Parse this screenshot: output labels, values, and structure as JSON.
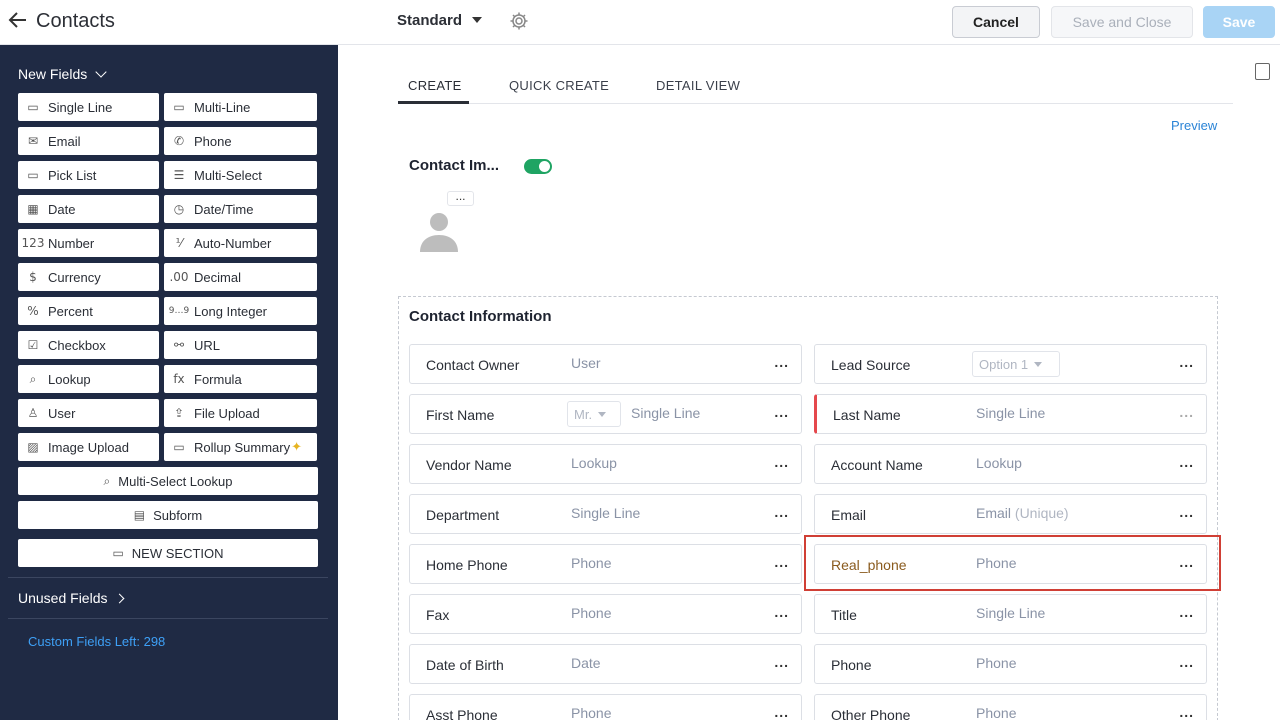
{
  "header": {
    "back_icon": "arrow-left-icon",
    "title": "Contacts",
    "layout_name": "Standard",
    "cancel_label": "Cancel",
    "save_close_label": "Save and Close",
    "save_label": "Save"
  },
  "sidebar": {
    "new_fields_label": "New Fields",
    "field_types": [
      {
        "label": "Single Line",
        "icon": "single-line-icon"
      },
      {
        "label": "Multi-Line",
        "icon": "multi-line-icon"
      },
      {
        "label": "Email",
        "icon": "email-icon"
      },
      {
        "label": "Phone",
        "icon": "phone-icon"
      },
      {
        "label": "Pick List",
        "icon": "pick-list-icon"
      },
      {
        "label": "Multi-Select",
        "icon": "multi-select-icon"
      },
      {
        "label": "Date",
        "icon": "date-icon"
      },
      {
        "label": "Date/Time",
        "icon": "date-time-icon"
      },
      {
        "label": "Number",
        "icon": "number-icon"
      },
      {
        "label": "Auto-Number",
        "icon": "auto-number-icon"
      },
      {
        "label": "Currency",
        "icon": "currency-icon"
      },
      {
        "label": "Decimal",
        "icon": "decimal-icon"
      },
      {
        "label": "Percent",
        "icon": "percent-icon"
      },
      {
        "label": "Long Integer",
        "icon": "long-integer-icon"
      },
      {
        "label": "Checkbox",
        "icon": "checkbox-icon"
      },
      {
        "label": "URL",
        "icon": "url-icon"
      },
      {
        "label": "Lookup",
        "icon": "lookup-icon"
      },
      {
        "label": "Formula",
        "icon": "formula-icon"
      },
      {
        "label": "User",
        "icon": "user-icon"
      },
      {
        "label": "File Upload",
        "icon": "file-upload-icon"
      },
      {
        "label": "Image Upload",
        "icon": "image-upload-icon"
      },
      {
        "label": "Rollup Summary",
        "icon": "rollup-summary-icon"
      }
    ],
    "multi_select_lookup_label": "Multi-Select Lookup",
    "subform_label": "Subform",
    "new_section_label": "NEW SECTION",
    "unused_fields_label": "Unused Fields",
    "custom_fields_left": "Custom Fields Left: 298"
  },
  "main": {
    "tabs": [
      {
        "label": "CREATE",
        "active": true
      },
      {
        "label": "QUICK CREATE",
        "active": false
      },
      {
        "label": "DETAIL VIEW",
        "active": false
      }
    ],
    "preview_label": "Preview",
    "contact_image_label": "Contact Im...",
    "contact_image_enabled": true,
    "section_title": "Contact Information",
    "left_fields": [
      {
        "label": "Contact Owner",
        "type": "User"
      },
      {
        "label": "First Name",
        "type": "Single Line",
        "salutation": "Mr."
      },
      {
        "label": "Vendor Name",
        "type": "Lookup"
      },
      {
        "label": "Department",
        "type": "Single Line"
      },
      {
        "label": "Home Phone",
        "type": "Phone"
      },
      {
        "label": "Fax",
        "type": "Phone"
      },
      {
        "label": "Date of Birth",
        "type": "Date"
      },
      {
        "label": "Asst Phone",
        "type": "Phone"
      }
    ],
    "right_fields": [
      {
        "label": "Lead Source",
        "type": "Option 1"
      },
      {
        "label": "Last Name",
        "type": "Single Line",
        "mandatory": true
      },
      {
        "label": "Account Name",
        "type": "Lookup"
      },
      {
        "label": "Email",
        "type": "Email",
        "suffix": "(Unique)"
      },
      {
        "label": "Real_phone",
        "type": "Phone",
        "highlighted": true
      },
      {
        "label": "Title",
        "type": "Single Line"
      },
      {
        "label": "Phone",
        "type": "Phone"
      },
      {
        "label": "Other Phone",
        "type": "Phone"
      }
    ],
    "more_label": "..."
  },
  "colors": {
    "sidebar_bg": "#1f2a44",
    "accent_blue": "#2b84d6",
    "toggle_green": "#1fa463",
    "highlight_red": "#d03f35",
    "mandatory_red": "#e5484d"
  }
}
